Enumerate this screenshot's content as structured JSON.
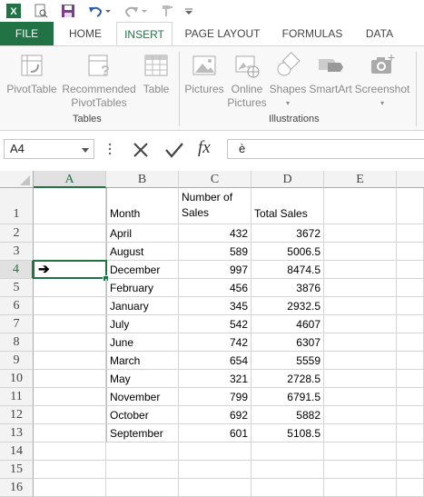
{
  "quick_access": {
    "icons": [
      "excel-logo-icon",
      "print-preview-icon",
      "save-icon",
      "undo-icon",
      "undo-dropdown-icon",
      "redo-icon",
      "redo-dropdown-icon",
      "format-painter-icon",
      "customize-qat-icon"
    ]
  },
  "tabs": [
    "FILE",
    "HOME",
    "INSERT",
    "PAGE LAYOUT",
    "FORMULAS",
    "DATA"
  ],
  "ribbon": {
    "tables": {
      "name": "Tables",
      "buttons": [
        {
          "label": "PivotTable"
        },
        {
          "label": "Recommended PivotTables",
          "line1": "Recommended",
          "line2": "PivotTables"
        },
        {
          "label": "Table"
        }
      ]
    },
    "illustrations": {
      "name": "Illustrations",
      "buttons": [
        {
          "label": "Pictures"
        },
        {
          "label": "Online Pictures",
          "line1": "Online",
          "line2": "Pictures"
        },
        {
          "label": "Shapes"
        },
        {
          "label": "SmartArt"
        },
        {
          "label": "Screenshot"
        }
      ]
    }
  },
  "formula_bar": {
    "name_box": "A4",
    "fx_label": "fx",
    "content": "è"
  },
  "sheet": {
    "columns": [
      "A",
      "B",
      "C",
      "D",
      "E"
    ],
    "selected_column": "A",
    "selected_row": 4,
    "rows": [
      "1",
      "2",
      "3",
      "4",
      "5",
      "6",
      "7",
      "8",
      "9",
      "10",
      "11",
      "12",
      "13",
      "14",
      "15",
      "16"
    ],
    "headers": {
      "month": "Month",
      "units_line1": "Number of",
      "units_line2": "Sales",
      "total": "Total Sales"
    },
    "active_cell_symbol": "➔",
    "data": [
      {
        "month": "April",
        "units": "432",
        "total": "3672"
      },
      {
        "month": "August",
        "units": "589",
        "total": "5006.5"
      },
      {
        "month": "December",
        "units": "997",
        "total": "8474.5"
      },
      {
        "month": "February",
        "units": "456",
        "total": "3876"
      },
      {
        "month": "January",
        "units": "345",
        "total": "2932.5"
      },
      {
        "month": "July",
        "units": "542",
        "total": "4607"
      },
      {
        "month": "June",
        "units": "742",
        "total": "6307"
      },
      {
        "month": "March",
        "units": "654",
        "total": "5559"
      },
      {
        "month": "May",
        "units": "321",
        "total": "2728.5"
      },
      {
        "month": "November",
        "units": "799",
        "total": "6791.5"
      },
      {
        "month": "October",
        "units": "692",
        "total": "5882"
      },
      {
        "month": "September",
        "units": "601",
        "total": "5108.5"
      }
    ]
  },
  "colors": {
    "excel_green": "#217346",
    "header_bg": "#f3f3f3",
    "grid": "#d4d4d4",
    "ribbon_bg": "#f8f8f8"
  }
}
